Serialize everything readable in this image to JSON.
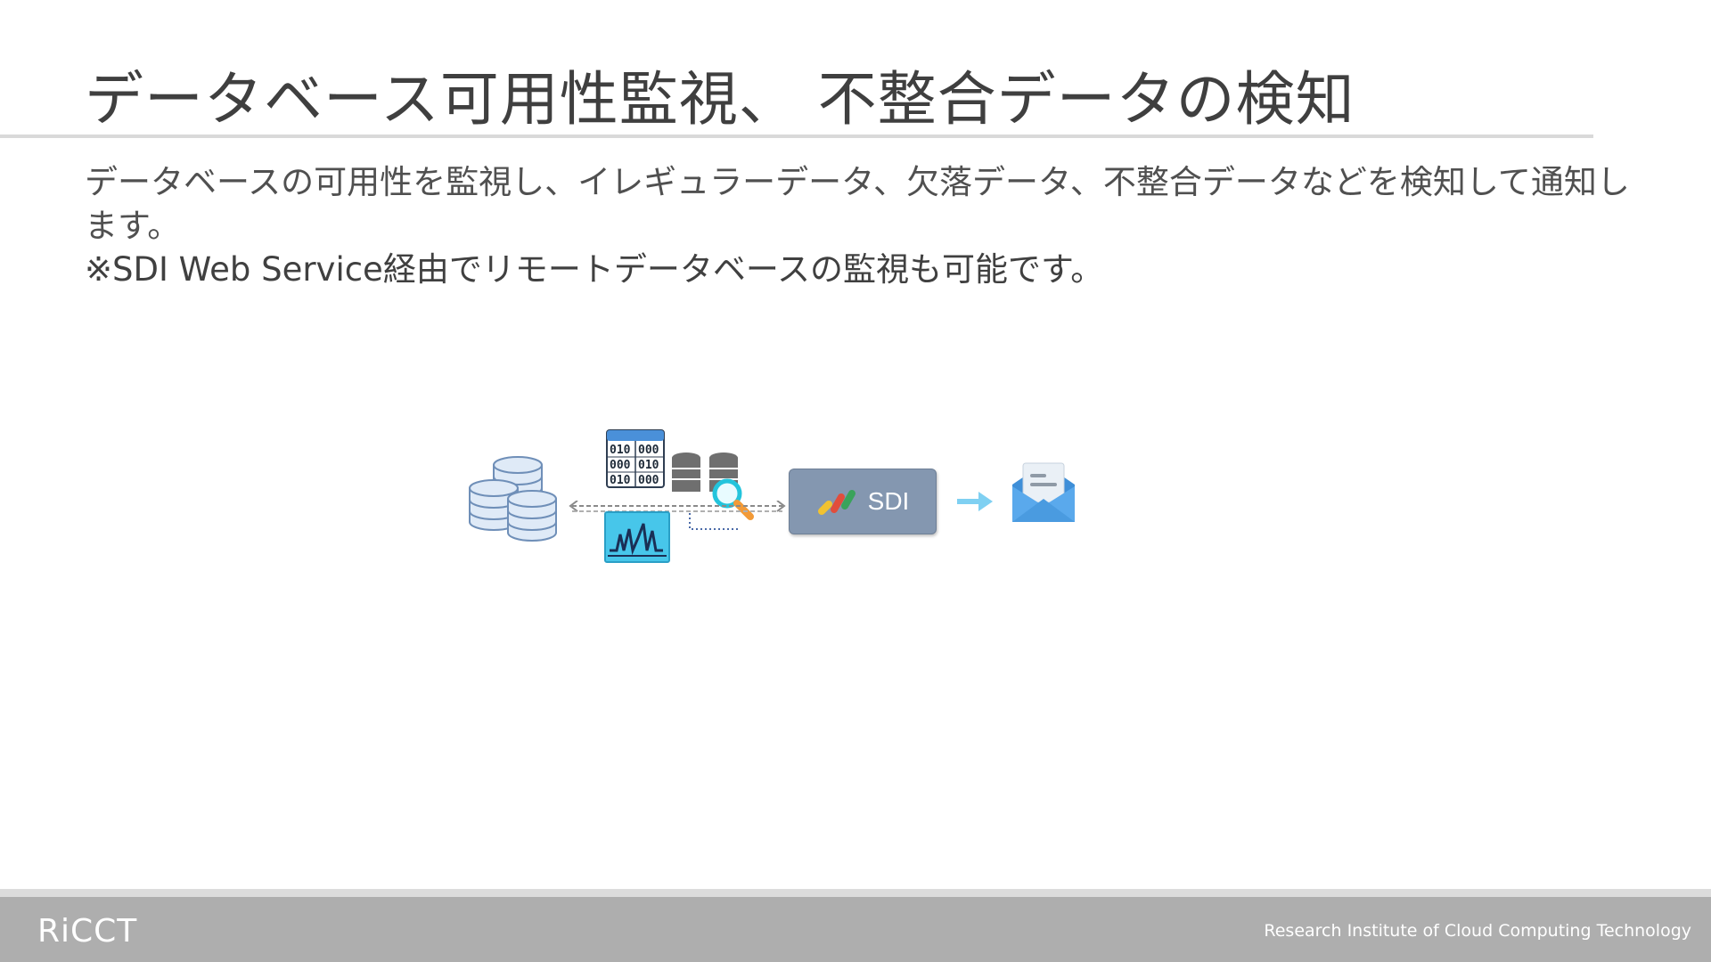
{
  "slide": {
    "title": "データベース可用性監視、 不整合データの検知",
    "body_line1": "データベースの可用性を監視し、イレギュラーデータ、欠落データ、不整合データなどを検知して通知します。",
    "body_line2": "※SDI Web Service経由でリモートデータベースの監視も可能です。"
  },
  "diagram": {
    "sdi_label": "SDI",
    "binary_rows": [
      "010",
      "000",
      "000",
      "010",
      "010",
      "000"
    ],
    "icons": [
      "database-cluster-icon",
      "binary-data-icon",
      "waveform-monitor-icon",
      "database-search-icon",
      "sdi-logo-icon",
      "right-arrow-icon",
      "mail-notification-icon"
    ]
  },
  "footer": {
    "logo": "RiCCT",
    "tagline": "Research Institute of Cloud Computing Technology"
  },
  "colors": {
    "title": "#3f3f3f",
    "sdi_box": "#8497b0",
    "footer": "#aeaeae",
    "database": "#d6e4f5",
    "mail": "#4a9be0"
  }
}
